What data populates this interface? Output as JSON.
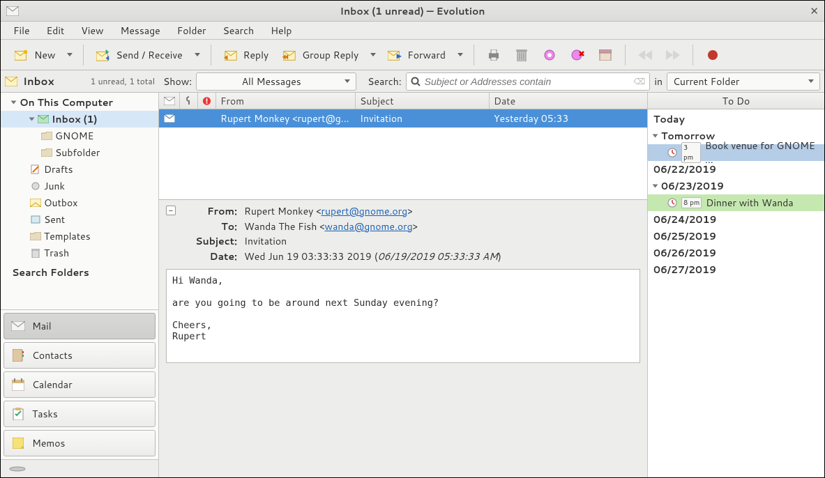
{
  "titlebar": {
    "title": "Inbox (1 unread) — Evolution"
  },
  "menubar": {
    "items": [
      "File",
      "Edit",
      "View",
      "Message",
      "Folder",
      "Search",
      "Help"
    ]
  },
  "toolbar": {
    "new": "New",
    "send_receive": "Send / Receive",
    "reply": "Reply",
    "group_reply": "Group Reply",
    "forward": "Forward"
  },
  "filterbar": {
    "sidebar_title_icon": "inbox-icon",
    "sidebar_title": "Inbox",
    "sidebar_status": "1 unread, 1 total",
    "show_label": "Show:",
    "show_value": "All Messages",
    "search_label": "Search:",
    "search_placeholder": "Subject or Addresses contain",
    "in_label": "in",
    "in_value": "Current Folder"
  },
  "folders": {
    "root": "On This Computer",
    "inbox": "Inbox (1)",
    "gnome": "GNOME",
    "subfolder": "Subfolder",
    "drafts": "Drafts",
    "junk": "Junk",
    "outbox": "Outbox",
    "sent": "Sent",
    "templates": "Templates",
    "trash": "Trash",
    "search": "Search Folders"
  },
  "switcher": {
    "mail": "Mail",
    "contacts": "Contacts",
    "calendar": "Calendar",
    "tasks": "Tasks",
    "memos": "Memos"
  },
  "list": {
    "columns": {
      "from": "From",
      "subject": "Subject",
      "date": "Date"
    },
    "rows": [
      {
        "from": "Rupert Monkey <rupert@g...",
        "subject": "Invitation",
        "date": "Yesterday 05:33"
      }
    ]
  },
  "preview": {
    "from_label": "From:",
    "from_name": "Rupert Monkey <",
    "from_email": "rupert@gnome.org",
    "from_close": ">",
    "to_label": "To:",
    "to_name": "Wanda The Fish <",
    "to_email": "wanda@gnome.org",
    "to_close": ">",
    "subject_label": "Subject:",
    "subject": "Invitation",
    "date_label": "Date:",
    "date_main": "Wed Jun 19 03:33:33 2019 (",
    "date_local": "06/19/2019 05:33:33 AM",
    "date_close": ")",
    "body": "Hi Wanda,\n\nare you going to be around next Sunday evening?\n\nCheers,\nRupert"
  },
  "todo": {
    "header": "To Do",
    "today": "Today",
    "tomorrow": "Tomorrow",
    "t1_time": "3 pm",
    "t1_text": "Book venue for GNOME ...",
    "d1": "06/22/2019",
    "d2": "06/23/2019",
    "t2_time": "8 pm",
    "t2_text": "Dinner with Wanda",
    "d3": "06/24/2019",
    "d4": "06/25/2019",
    "d5": "06/26/2019",
    "d6": "06/27/2019"
  }
}
